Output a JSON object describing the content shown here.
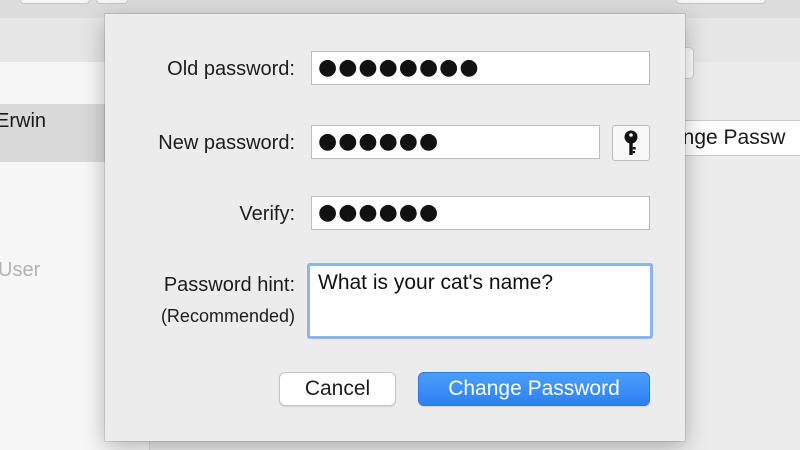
{
  "background": {
    "sidebar": {
      "selected_user": "Erwin",
      "other_user": "User"
    },
    "change_password_button": "ange Passw"
  },
  "dialog": {
    "old_password": {
      "label": "Old password:",
      "value": "●●●●●●●●"
    },
    "new_password": {
      "label": "New password:",
      "value": "●●●●●●"
    },
    "key_button_icon": "key-icon",
    "verify": {
      "label": "Verify:",
      "value": "●●●●●●"
    },
    "hint": {
      "label": "Password hint:",
      "sublabel": "(Recommended)",
      "value": "What is your cat's name?"
    },
    "buttons": {
      "cancel": "Cancel",
      "confirm": "Change Password"
    }
  },
  "colors": {
    "accent": "#3a8ef6",
    "focus_ring": "#8fb4ea",
    "sheet_background": "#ececec"
  }
}
